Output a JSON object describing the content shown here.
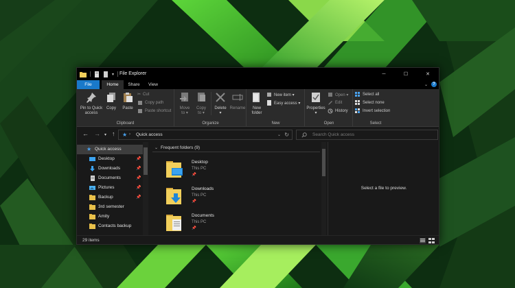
{
  "window": {
    "title": "File Explorer",
    "controls": {
      "minimize": "─",
      "maximize": "☐",
      "close": "✕"
    }
  },
  "tabs": {
    "file": "File",
    "home": "Home",
    "share": "Share",
    "view": "View"
  },
  "ribbon": {
    "clipboard": {
      "label": "Clipboard",
      "pin_line1": "Pin to Quick",
      "pin_line2": "access",
      "copy": "Copy",
      "paste": "Paste",
      "cut": "Cut",
      "copy_path": "Copy path",
      "paste_shortcut": "Paste shortcut"
    },
    "organize": {
      "label": "Organize",
      "move_line1": "Move",
      "move_line2": "to ▾",
      "copy_line1": "Copy",
      "copy_line2": "to ▾",
      "delete_line1": "Delete",
      "delete_line2": "▾",
      "rename": "Rename"
    },
    "new": {
      "label": "New",
      "folder_line1": "New",
      "folder_line2": "folder",
      "new_item": "New item ▾",
      "easy_access": "Easy access ▾"
    },
    "open": {
      "label": "Open",
      "properties_line1": "Properties",
      "properties_line2": "▾",
      "open": "Open ▾",
      "edit": "Edit",
      "history": "History"
    },
    "select": {
      "label": "Select",
      "select_all": "Select all",
      "select_none": "Select none",
      "invert_selection": "Invert selection"
    }
  },
  "address": {
    "path": "Quick access",
    "search_placeholder": "Search Quick access"
  },
  "nav": {
    "items": [
      {
        "label": "Quick access",
        "icon": "star-icon",
        "pinned": false
      },
      {
        "label": "Desktop",
        "icon": "desktop-icon",
        "pinned": true
      },
      {
        "label": "Downloads",
        "icon": "download-icon",
        "pinned": true
      },
      {
        "label": "Documents",
        "icon": "documents-icon",
        "pinned": true
      },
      {
        "label": "Pictures",
        "icon": "pictures-icon",
        "pinned": true
      },
      {
        "label": "Backup",
        "icon": "folder-icon",
        "pinned": true
      },
      {
        "label": "3rd semester",
        "icon": "folder-icon",
        "pinned": false
      },
      {
        "label": "Amity",
        "icon": "folder-icon",
        "pinned": false
      },
      {
        "label": "Contacts backup",
        "icon": "folder-icon",
        "pinned": false
      }
    ]
  },
  "content": {
    "group_header": "Frequent folders (9)",
    "items": [
      {
        "name": "Desktop",
        "location": "This PC",
        "icon": "desktop-folder-icon"
      },
      {
        "name": "Downloads",
        "location": "This PC",
        "icon": "downloads-folder-icon"
      },
      {
        "name": "Documents",
        "location": "This PC",
        "icon": "documents-folder-icon"
      }
    ]
  },
  "preview": {
    "text": "Select a file to preview."
  },
  "status": {
    "items_count": "29 items"
  },
  "colors": {
    "accent": "#1979ca",
    "folder": "#e8c04a",
    "window_bg": "#191919",
    "ribbon_bg": "#2b2b2b"
  }
}
